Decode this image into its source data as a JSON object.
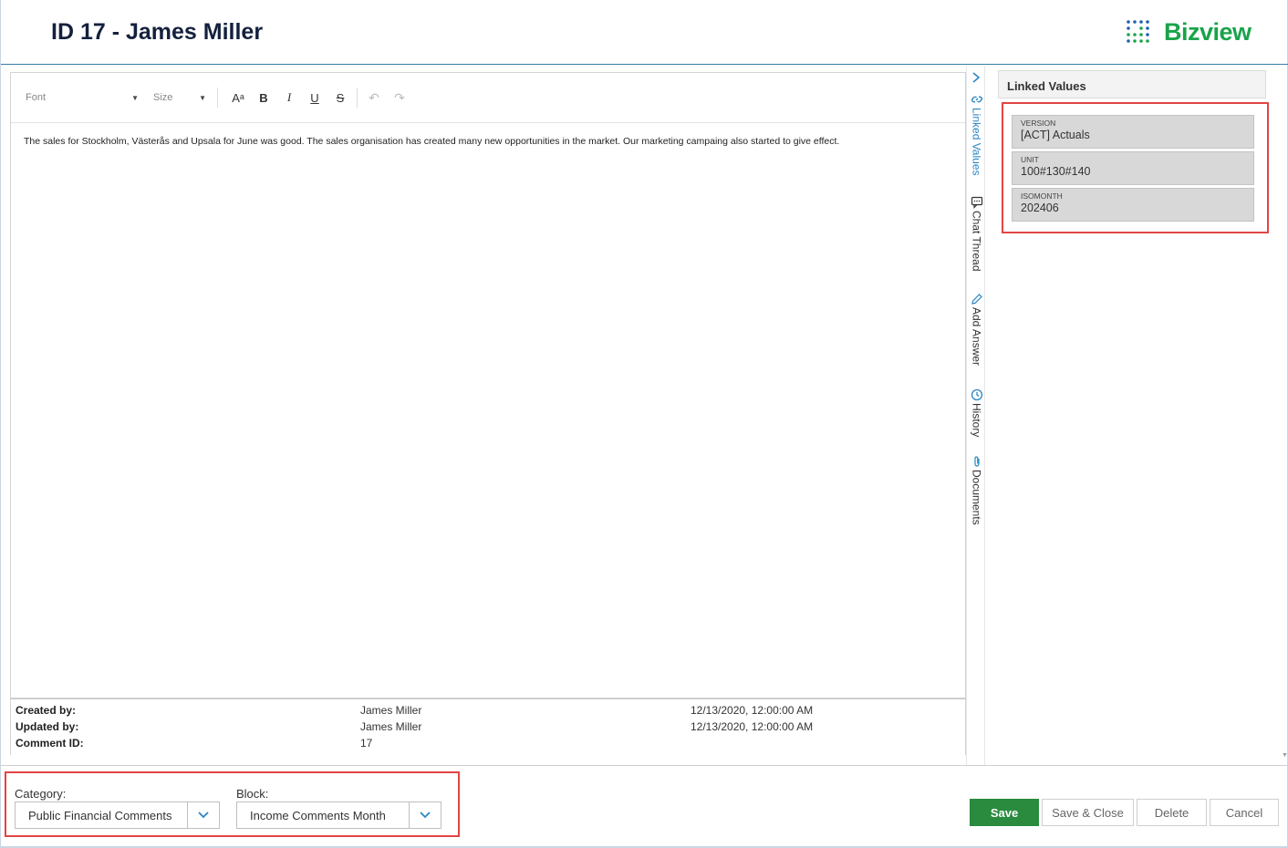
{
  "header": {
    "title": "ID 17 - James Miller",
    "logo_text": "Bizview",
    "brand_color": "#1aa34a"
  },
  "editor": {
    "toolbar": {
      "font_placeholder": "Font",
      "size_placeholder": "Size",
      "font_color": "Aᵃ",
      "bold": "B",
      "italic": "I",
      "underline": "U",
      "strikethrough": "S",
      "undo": "↶",
      "redo": "↷"
    },
    "content": "The sales for Stockholm, Västerås and Upsala for June was good. The sales organisation has created many new opportunities in the market. Our marketing campaing also started to give effect."
  },
  "meta": {
    "created_by_label": "Created by:",
    "created_by_name": "James Miller",
    "created_date": "12/13/2020, 12:00:00 AM",
    "updated_by_label": "Updated by:",
    "updated_by_name": "James Miller",
    "updated_date": "12/13/2020, 12:00:00 AM",
    "comment_id_label": "Comment ID:",
    "comment_id": "17"
  },
  "side_tabs": [
    {
      "label": "Linked Values",
      "icon": "link-icon",
      "active": true
    },
    {
      "label": "Chat Thread",
      "icon": "chat-icon",
      "active": false
    },
    {
      "label": "Add Answer",
      "icon": "pencil-icon",
      "active": false
    },
    {
      "label": "History",
      "icon": "history-icon",
      "active": false
    },
    {
      "label": "Documents",
      "icon": "paperclip-icon",
      "active": false
    }
  ],
  "linked_values": {
    "title": "Linked Values",
    "fields": [
      {
        "label": "VERSION",
        "value": "[ACT] Actuals"
      },
      {
        "label": "UNIT",
        "value": "100#130#140"
      },
      {
        "label": "ISOMONTH",
        "value": "202406"
      }
    ]
  },
  "footer": {
    "category_label": "Category:",
    "category_value": "Public Financial Comments",
    "block_label": "Block:",
    "block_value": "Income Comments Month",
    "buttons": {
      "save": "Save",
      "save_close": "Save & Close",
      "delete": "Delete",
      "cancel": "Cancel"
    },
    "accent_color": "#2a8a3e"
  }
}
